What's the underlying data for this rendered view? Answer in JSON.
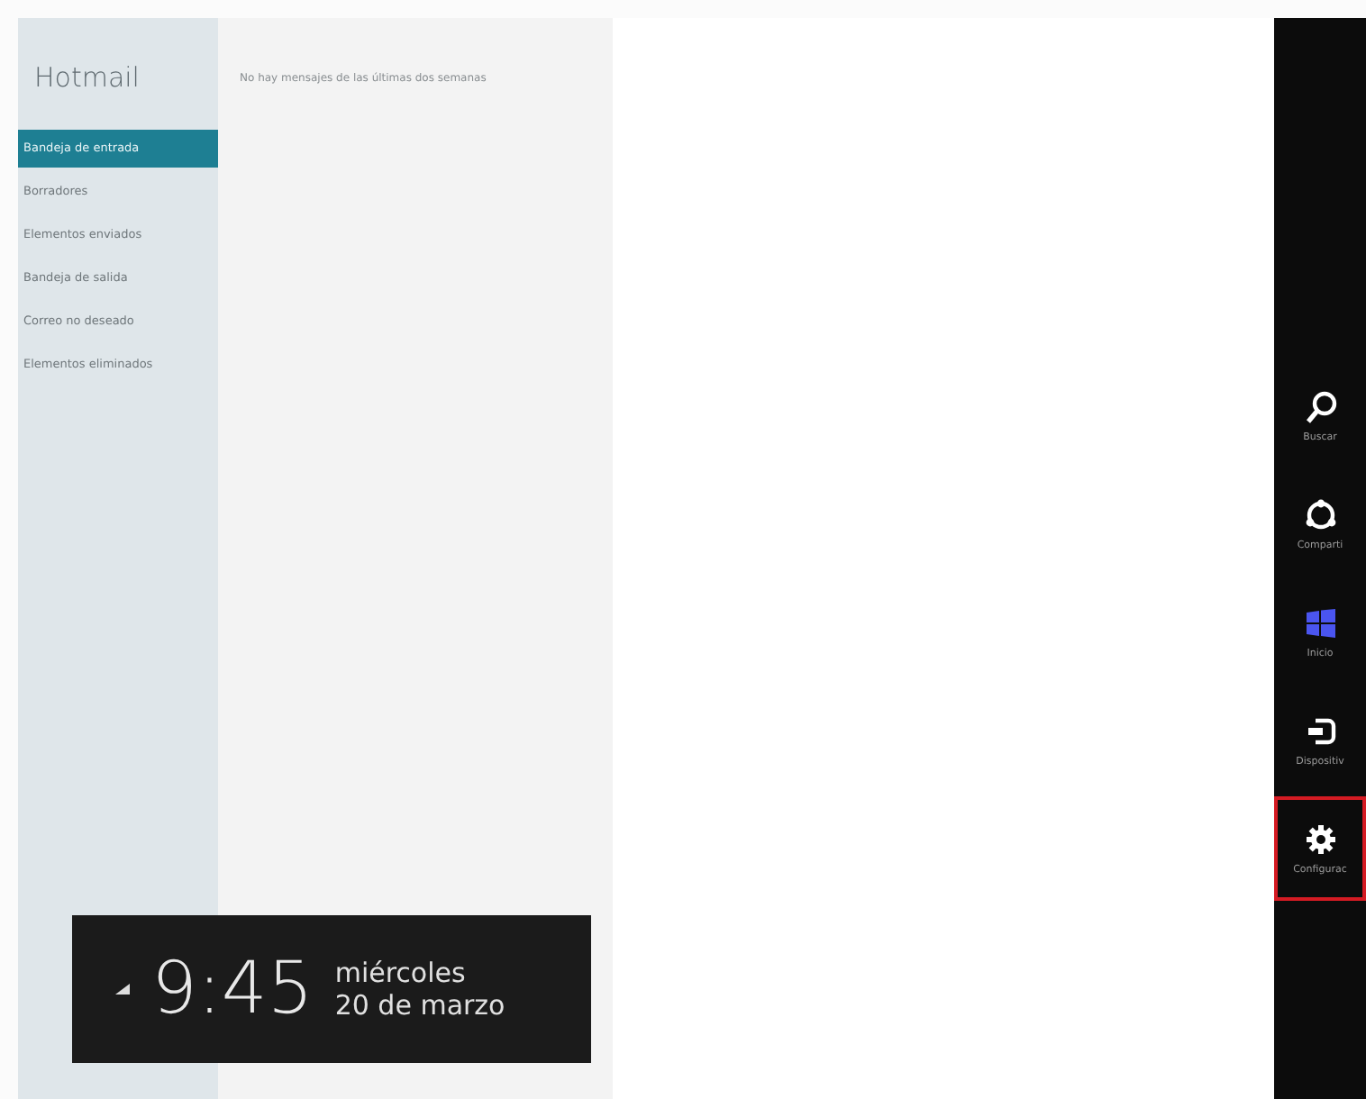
{
  "app": {
    "title": "Hotmail"
  },
  "folders": [
    {
      "label": "Bandeja de entrada",
      "selected": true
    },
    {
      "label": "Borradores",
      "selected": false
    },
    {
      "label": "Elementos enviados",
      "selected": false
    },
    {
      "label": "Bandeja de salida",
      "selected": false
    },
    {
      "label": "Correo no deseado",
      "selected": false
    },
    {
      "label": "Elementos eliminados",
      "selected": false
    }
  ],
  "message_list": {
    "empty_text": "No hay mensajes de las últimas dos semanas"
  },
  "clock": {
    "time": "9:45",
    "weekday": "miércoles",
    "date": "20 de marzo"
  },
  "charms": [
    {
      "kind": "search",
      "label": "Buscar",
      "selected": false
    },
    {
      "kind": "share",
      "label": "Comparti",
      "selected": false
    },
    {
      "kind": "start",
      "label": "Inicio",
      "selected": false
    },
    {
      "kind": "devices",
      "label": "Dispositiv",
      "selected": false
    },
    {
      "kind": "settings",
      "label": "Configurac",
      "selected": true
    }
  ]
}
